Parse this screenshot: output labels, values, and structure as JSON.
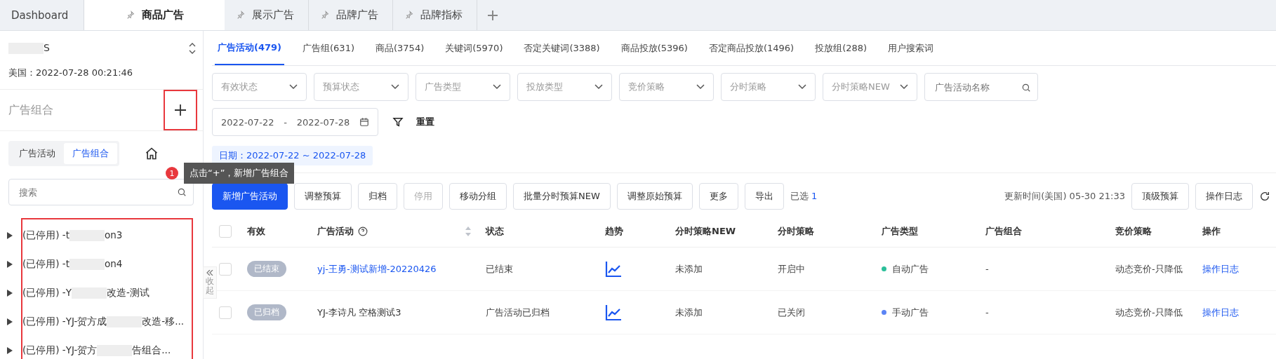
{
  "tabs": [
    {
      "label": "Dashboard",
      "pinned": false,
      "selected": false
    },
    {
      "label": "商品广告",
      "pinned": true,
      "selected": true
    },
    {
      "label": "展示广告",
      "pinned": true,
      "selected": false
    },
    {
      "label": "品牌广告",
      "pinned": true,
      "selected": false
    },
    {
      "label": "品牌指标",
      "pinned": true,
      "selected": false
    }
  ],
  "sidebar": {
    "account": "S",
    "time": "美国：2022-07-28 00:21:46",
    "section_title": "广告组合",
    "add_highlighted": true,
    "list_highlighted": true,
    "segments": [
      {
        "label": "广告活动",
        "selected": false
      },
      {
        "label": "广告组合",
        "selected": true
      }
    ],
    "search": {
      "placeholder": "搜索"
    },
    "items": [
      {
        "start": "(已停用) -t",
        "end": "on3"
      },
      {
        "start": "(已停用) -t",
        "end": "on4"
      },
      {
        "start": "(已停用) -Y",
        "end": "改造-测试"
      },
      {
        "start": "(已停用) -YJ-贺方成",
        "end": "改造-移..."
      },
      {
        "start": "(已停用) -YJ-贺方",
        "end": "告组合..."
      }
    ],
    "collapse": "收起"
  },
  "tooltip": {
    "badge": "1",
    "text": "点击“+”，新增广告组合"
  },
  "subtabs": [
    {
      "label": "广告活动(479)",
      "selected": true
    },
    {
      "label": "广告组(631)",
      "selected": false
    },
    {
      "label": "商品(3754)",
      "selected": false
    },
    {
      "label": "关键词(5970)",
      "selected": false
    },
    {
      "label": "否定关键词(3388)",
      "selected": false
    },
    {
      "label": "商品投放(5396)",
      "selected": false
    },
    {
      "label": "否定商品投放(1496)",
      "selected": false
    },
    {
      "label": "投放组(288)",
      "selected": false
    },
    {
      "label": "用户搜索词",
      "selected": false
    }
  ],
  "filters": [
    {
      "kind": "select",
      "label": "有效状态"
    },
    {
      "kind": "select",
      "label": "预算状态"
    },
    {
      "kind": "select",
      "label": "广告类型"
    },
    {
      "kind": "select",
      "label": "投放类型"
    },
    {
      "kind": "select",
      "label": "竞价策略"
    },
    {
      "kind": "select",
      "label": "分时策略"
    },
    {
      "kind": "select",
      "label": "分时策略NEW"
    },
    {
      "kind": "search",
      "placeholder": "广告活动名称"
    }
  ],
  "date_range": {
    "start": "2022-07-22",
    "separator": "-",
    "end": "2022-07-28"
  },
  "reset": "重置",
  "date_tag": "日期：2022-07-22 ~ 2022-07-28",
  "actions": [
    {
      "label": "新增广告活动",
      "primary": true,
      "disabled": false
    },
    {
      "label": "调整预算",
      "primary": false,
      "disabled": false
    },
    {
      "label": "归档",
      "primary": false,
      "disabled": false
    },
    {
      "label": "停用",
      "primary": false,
      "disabled": true
    },
    {
      "label": "移动分组",
      "primary": false,
      "disabled": false
    },
    {
      "label": "批量分时预算NEW",
      "primary": false,
      "disabled": false
    },
    {
      "label": "调整原始预算",
      "primary": false,
      "disabled": false
    },
    {
      "label": "更多",
      "primary": false,
      "disabled": false
    },
    {
      "label": "导出",
      "primary": false,
      "disabled": false
    }
  ],
  "selected_count": {
    "label": "已选",
    "count": "1"
  },
  "update_time": "更新时间(美国) 05-30 21:33",
  "right_buttons": [
    "顶级预算",
    "操作日志"
  ],
  "table": {
    "all_checked": false,
    "columns": [
      {
        "label": "有效",
        "kind": "plain"
      },
      {
        "label": "广告活动",
        "kind": "sortable"
      },
      {
        "label": "状态",
        "kind": "plain"
      },
      {
        "label": "趋势",
        "kind": "plain"
      },
      {
        "label": "分时策略NEW",
        "kind": "plain"
      },
      {
        "label": "分时策略",
        "kind": "plain"
      },
      {
        "label": "广告类型",
        "kind": "plain"
      },
      {
        "label": "广告组合",
        "kind": "plain"
      },
      {
        "label": "竞价策略",
        "kind": "plain"
      },
      {
        "label": "操作",
        "kind": "plain"
      }
    ],
    "rows": [
      {
        "checked": false,
        "badge": "已结束",
        "name": "yj-王勇-测试新增-20220426",
        "name_is_link": true,
        "status": "已结束",
        "strategy_new": "未添加",
        "strategy": "开启中",
        "ad_type": "自动广告",
        "color": "#2bbf9a",
        "portfolio": "-",
        "bidding": "动态竞价-只降低",
        "action": "操作日志"
      },
      {
        "checked": false,
        "badge": "已归档",
        "name": "YJ-李诗凡 空格测试3",
        "name_is_link": false,
        "status": "广告活动已归档",
        "strategy_new": "未添加",
        "strategy": "已关闭",
        "ad_type": "手动广告",
        "color": "#5b84f5",
        "portfolio": "-",
        "bidding": "动态竞价-只降低",
        "action": "操作日志"
      }
    ]
  }
}
